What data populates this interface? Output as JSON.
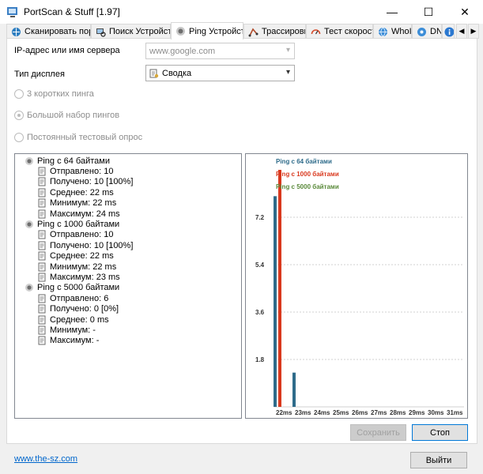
{
  "window": {
    "title": "PortScan & Stuff [1.97]",
    "controls": {
      "minimize": "—",
      "maximize": "☐",
      "close": "✕"
    }
  },
  "tabs": [
    {
      "label": "Сканировать порты",
      "icon": "network-scan-icon"
    },
    {
      "label": "Поиск Устройства",
      "icon": "device-search-icon"
    },
    {
      "label": "Ping Устройства",
      "icon": "ping-icon",
      "active": true
    },
    {
      "label": "Трассировка",
      "icon": "trace-icon"
    },
    {
      "label": "Тест скорости",
      "icon": "speedometer-icon"
    },
    {
      "label": "WhoIs",
      "icon": "globe-icon"
    },
    {
      "label": "DNS",
      "icon": "dns-icon"
    }
  ],
  "form": {
    "host_label": "IP-адрес или имя сервера",
    "host_placeholder": "www.google.com",
    "display_label": "Тип дисплея",
    "display_value": "Сводка"
  },
  "radios": [
    {
      "label": "3 коротких пинга",
      "checked": false
    },
    {
      "label": "Большой набор пингов",
      "checked": true
    },
    {
      "label": "Постоянный тестовый опрос",
      "checked": false
    }
  ],
  "results": [
    {
      "title": "Ping с 64 байтами",
      "items": [
        "Отправлено: 10",
        "Получено: 10 [100%]",
        "Среднее: 22 ms",
        "Минимум: 22 ms",
        "Максимум: 24 ms"
      ]
    },
    {
      "title": "Ping с 1000 байтами",
      "items": [
        "Отправлено: 10",
        "Получено: 10 [100%]",
        "Среднее: 22 ms",
        "Минимум: 22 ms",
        "Максимум: 23 ms"
      ]
    },
    {
      "title": "Ping с 5000 байтами",
      "items": [
        "Отправлено: 6",
        "Получено: 0 [0%]",
        "Среднее: 0 ms",
        "Минимум: -",
        "Максимум: -"
      ]
    }
  ],
  "chart_data": {
    "type": "bar",
    "categories": [
      "22ms",
      "23ms",
      "24ms",
      "25ms",
      "26ms",
      "27ms",
      "28ms",
      "29ms",
      "30ms",
      "31ms"
    ],
    "series": [
      {
        "name": "Ping с 64 байтами",
        "color": "#2e6b8a",
        "values": [
          8,
          1.3,
          0,
          0,
          0,
          0,
          0,
          0,
          0,
          0
        ]
      },
      {
        "name": "Ping с 1000 байтами",
        "color": "#d9391e",
        "values": [
          9,
          0,
          0,
          0,
          0,
          0,
          0,
          0,
          0,
          0
        ]
      },
      {
        "name": "Ping с 5000 байтами",
        "color": "#5a8a3a",
        "values": [
          0,
          0,
          0,
          0,
          0,
          0,
          0,
          0,
          0,
          0
        ]
      }
    ],
    "yticks": [
      "7.2",
      "5.4",
      "3.6",
      "1.8"
    ],
    "ylim": [
      0,
      9
    ],
    "grid": true,
    "legend": "top-left"
  },
  "buttons": {
    "save": "Сохранить",
    "stop": "Стоп",
    "exit": "Выйти"
  },
  "footer": {
    "link": "www.the-sz.com"
  }
}
